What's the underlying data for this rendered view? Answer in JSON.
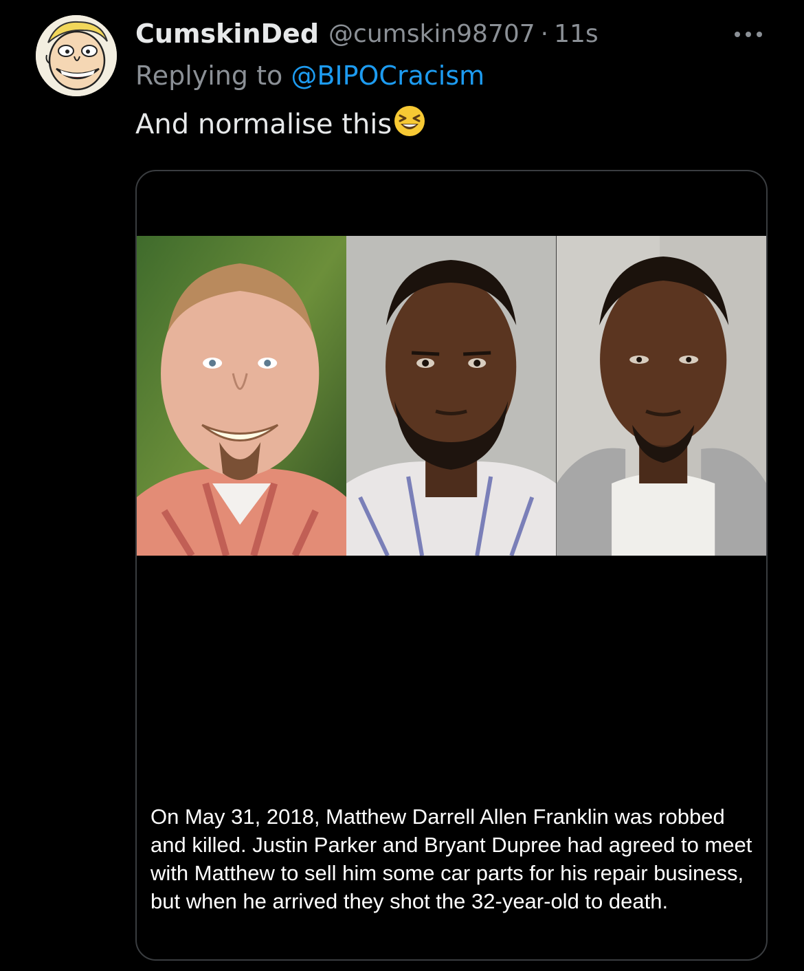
{
  "tweet": {
    "display_name": "CumskinDed",
    "handle": "@cumskin98707",
    "separator": "·",
    "time": "11s",
    "replying_prefix": "Replying to",
    "replying_to": "@BIPOCracism",
    "text": "And normalise this",
    "emoji_icon": "grinning-squinting-face-icon",
    "more_icon": "more-options-icon"
  },
  "media": {
    "photos": [
      {
        "name": "photo-matthew-franklin",
        "icon": "portrait-photo-icon"
      },
      {
        "name": "photo-justin-parker",
        "icon": "mugshot-photo-icon"
      },
      {
        "name": "photo-bryant-dupree",
        "icon": "mugshot-photo-icon"
      }
    ],
    "caption": "On May 31, 2018, Matthew Darrell Allen Franklin was robbed and killed. Justin Parker and Bryant Dupree had agreed to meet with Matthew to sell him some car parts for his repair business, but when he arrived they shot the 32-year-old to death."
  },
  "colors": {
    "background": "#000000",
    "text_primary": "#e7e9ea",
    "text_secondary": "#8b9096",
    "link": "#1d9bf0",
    "card_border": "#3a3d40"
  }
}
